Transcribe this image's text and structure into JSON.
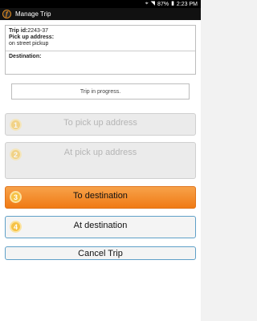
{
  "status_bar": {
    "location_icon": "location-icon",
    "wifi_icon": "wifi-icon",
    "battery_percent": "87%",
    "battery_icon": "battery-icon",
    "time": "2:23 PM"
  },
  "action_bar": {
    "title": "Manage Trip",
    "app_icon": "app-logo-icon"
  },
  "trip_info": {
    "trip_id_label": "Trip id:",
    "trip_id_value": "2243-37",
    "pickup_label": "Pick up address:",
    "pickup_value": "on street pickup",
    "destination_label": "Destination:",
    "destination_value": ""
  },
  "trip_status": "Trip in progress.",
  "steps": [
    {
      "number": "1",
      "label": "To pick up address",
      "enabled": false
    },
    {
      "number": "2",
      "label": "At pick up address",
      "enabled": false
    },
    {
      "number": "3",
      "label": "To destination",
      "enabled": true,
      "highlighted": true
    },
    {
      "number": "4",
      "label": "At destination",
      "enabled": true
    }
  ],
  "cancel_label": "Cancel Trip",
  "colors": {
    "accent": "#f07a14",
    "step_badge": "#f6c244",
    "button_border": "#5fa0c8"
  }
}
